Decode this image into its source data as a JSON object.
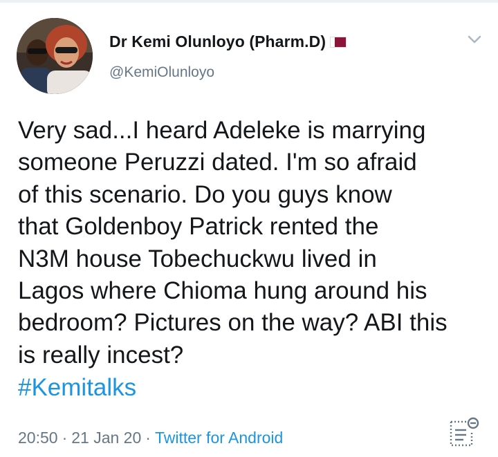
{
  "tweet": {
    "author": {
      "display_name": "Dr Kemi Olunloyo (Pharm.D)",
      "flag_icon": "qatar-flag-icon",
      "handle": "@KemiOlunloyo"
    },
    "text": "Very sad...I heard Adeleke is marrying\nsomeone Peruzzi dated. I'm so afraid\nof this scenario. Do you guys know\nthat Goldenboy Patrick rented the\nN3M house Tobechuckwu lived in\nLagos where Chioma hung around his\nbedroom? Pictures on the way? ABI this\nis really incest?",
    "hashtag": "#Kemitalks",
    "time": "20:50",
    "separator": "·",
    "date": "21 Jan 20",
    "source": "Twitter for Android"
  },
  "colors": {
    "text": "#14171a",
    "secondary": "#657786",
    "link": "#1b95e0"
  },
  "icons": {
    "menu": "chevron-down-icon",
    "analytics": "analytics-icon"
  }
}
